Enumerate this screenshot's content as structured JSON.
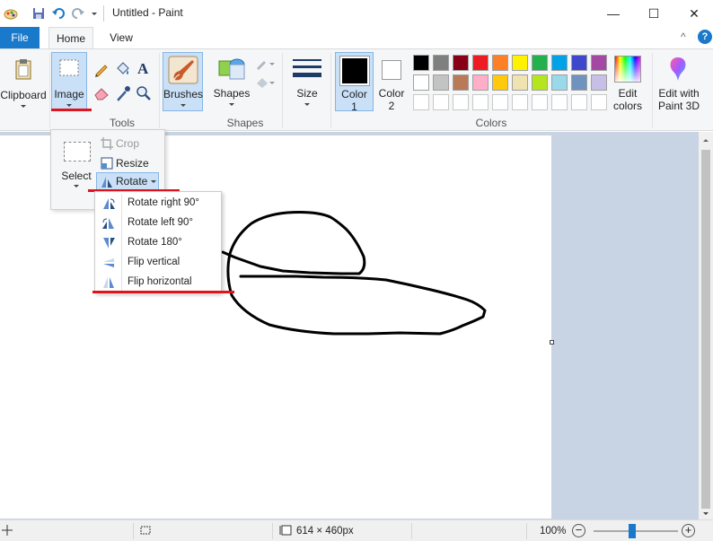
{
  "window": {
    "title": "Untitled - Paint",
    "minimize": "—",
    "maximize": "☐",
    "close": "✕"
  },
  "tabs": {
    "file": "File",
    "home": "Home",
    "view": "View"
  },
  "ribbon": {
    "clipboard": "Clipboard",
    "image": "Image",
    "tools_group": "Tools",
    "brushes": "Brushes",
    "shapes": "Shapes",
    "shapes_group": "Shapes",
    "size": "Size",
    "color1": [
      "Color",
      "1"
    ],
    "color2": [
      "Color",
      "2"
    ],
    "colors_group": "Colors",
    "edit_colors": [
      "Edit",
      "colors"
    ],
    "edit_paint3d": [
      "Edit with",
      "Paint 3D"
    ],
    "help_caret": "^",
    "help_glyph": "?"
  },
  "palette_row1": [
    "#000000",
    "#7f7f7f",
    "#880015",
    "#ed1c24",
    "#ff7f27",
    "#fff200",
    "#22b14c",
    "#00a2e8",
    "#3f48cc",
    "#a349a4"
  ],
  "palette_row2": [
    "#ffffff",
    "#c3c3c3",
    "#b97a57",
    "#ffaec9",
    "#ffc90e",
    "#efe4b0",
    "#b5e61d",
    "#99d9ea",
    "#7092be",
    "#c8bfe7"
  ],
  "image_panel": {
    "select": "Select",
    "crop": "Crop",
    "resize": "Resize",
    "rotate": "Rotate"
  },
  "rotate_menu": [
    "Rotate right 90°",
    "Rotate left 90°",
    "Rotate 180°",
    "Flip vertical",
    "Flip horizontal"
  ],
  "status": {
    "dimensions": "614 × 460px",
    "zoom": "100%"
  },
  "accent": "#1979ca"
}
